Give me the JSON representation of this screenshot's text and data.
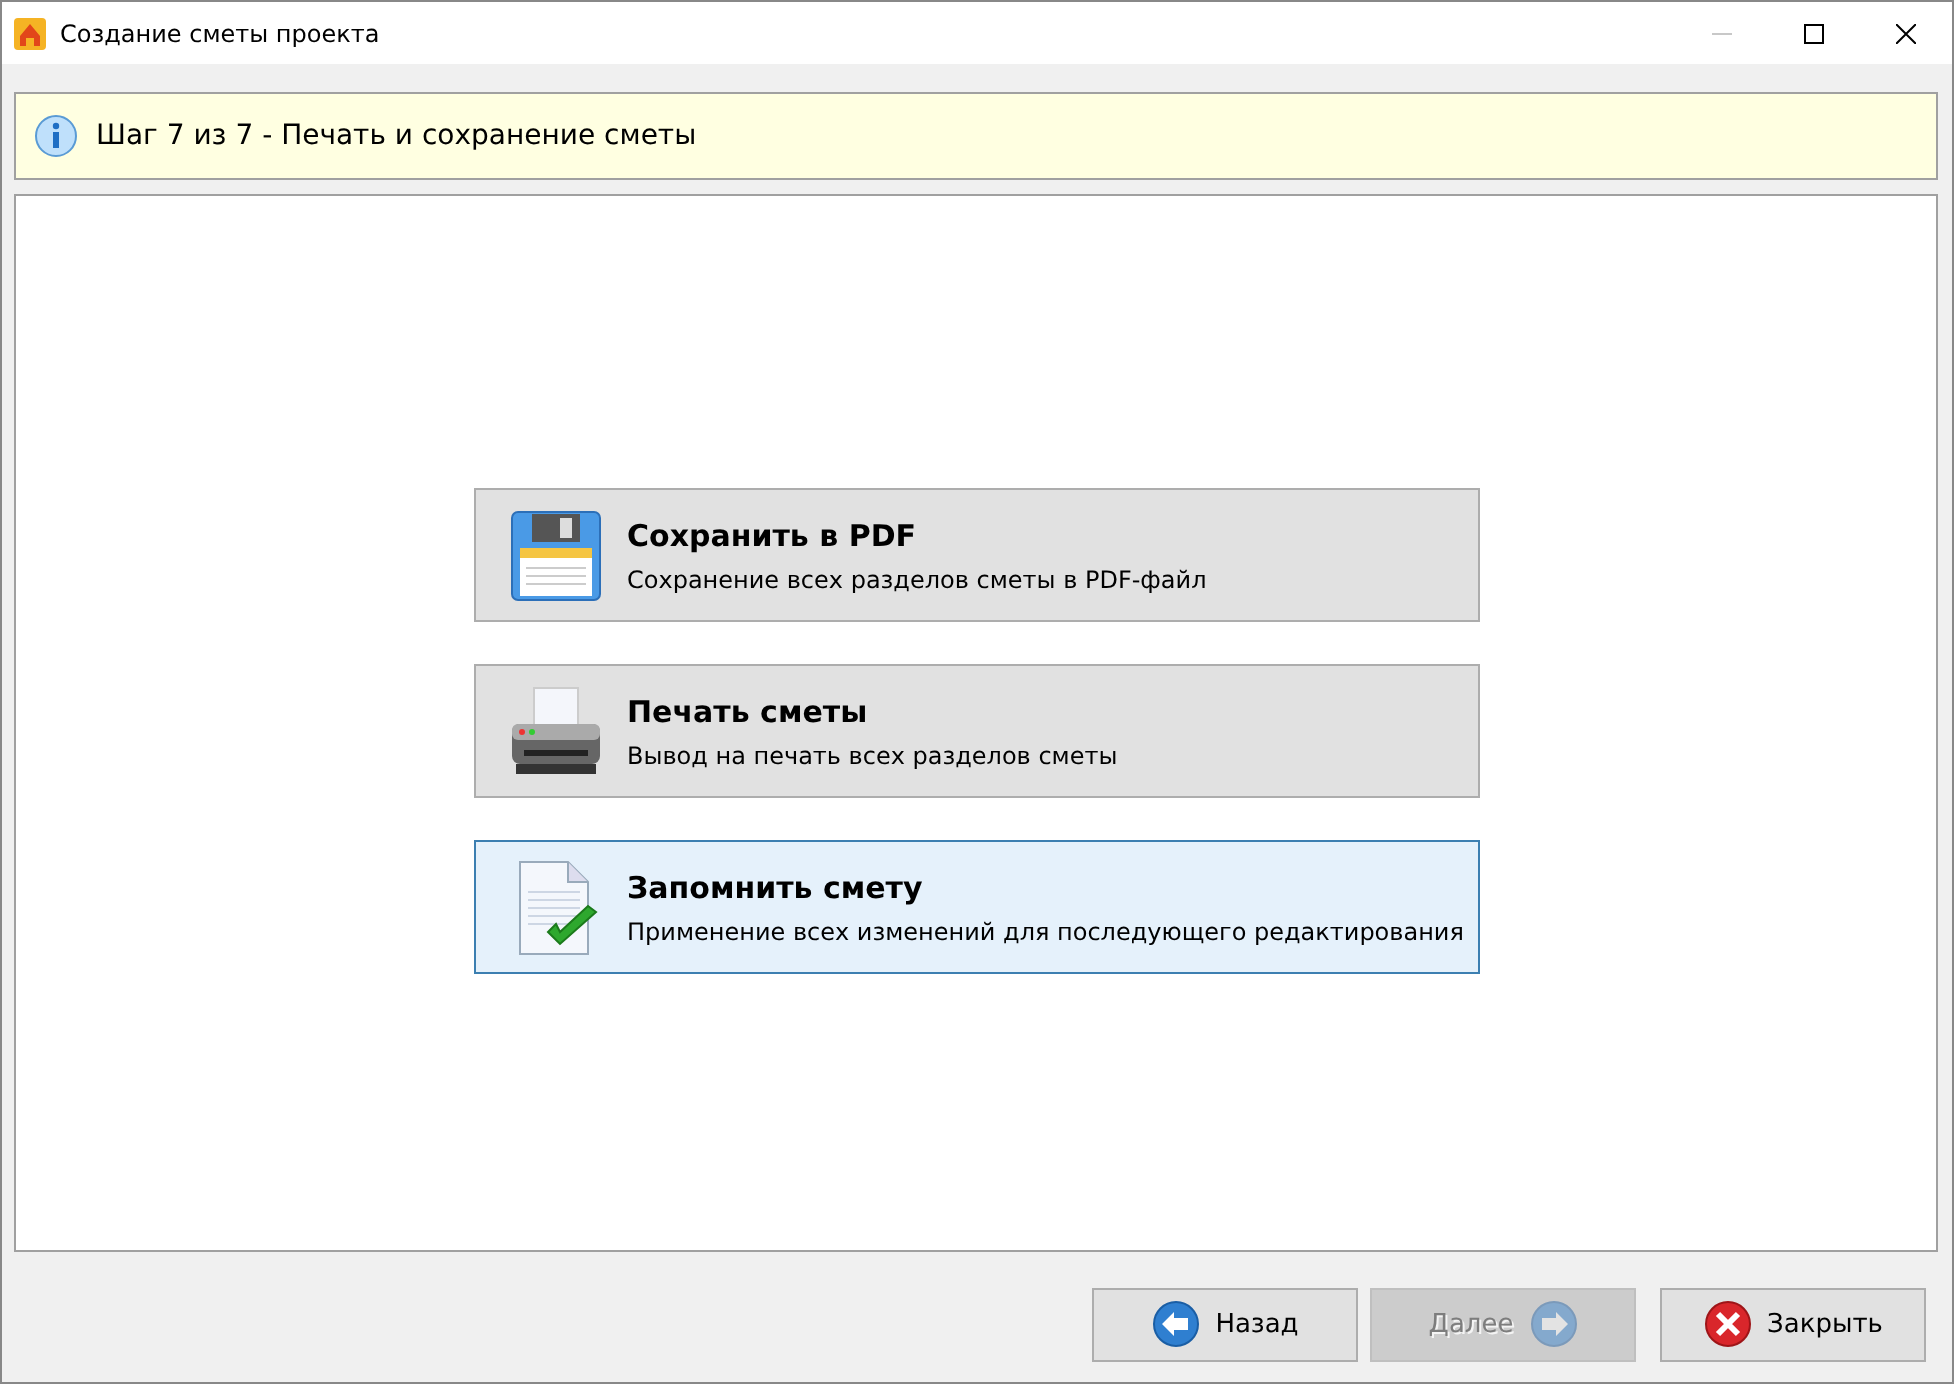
{
  "window": {
    "title": "Создание сметы проекта",
    "controls": [
      {
        "kind": "minimize",
        "disabled": true
      },
      {
        "kind": "maximize",
        "disabled": false
      },
      {
        "kind": "close",
        "disabled": false
      }
    ]
  },
  "step": {
    "text": "Шаг 7 из 7 - Печать и сохранение сметы"
  },
  "options": [
    {
      "kind": "save",
      "title": "Сохранить в PDF",
      "description": "Сохранение всех разделов сметы в PDF-файл",
      "selected": false
    },
    {
      "kind": "print",
      "title": "Печать сметы",
      "description": "Вывод на печать всех разделов сметы",
      "selected": false
    },
    {
      "kind": "remember",
      "title": "Запомнить смету",
      "description": "Применение всех изменений для последующего редактирования",
      "selected": true
    }
  ],
  "buttons": [
    {
      "kind": "back",
      "label": "Назад",
      "disabled": false
    },
    {
      "kind": "next",
      "label": "Далее",
      "disabled": true
    },
    {
      "kind": "close",
      "label": "Закрыть",
      "disabled": false
    }
  ]
}
